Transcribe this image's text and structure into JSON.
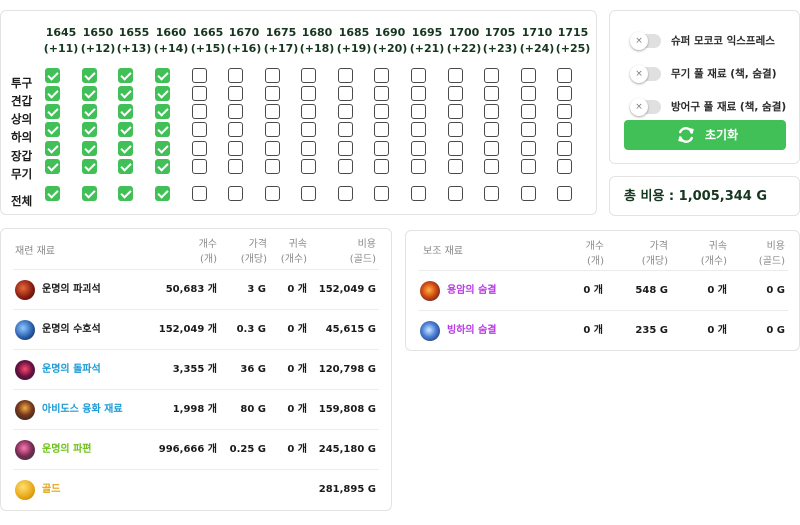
{
  "levels": [
    {
      "level": "1645",
      "bonus": "(+11)"
    },
    {
      "level": "1650",
      "bonus": "(+12)"
    },
    {
      "level": "1655",
      "bonus": "(+13)"
    },
    {
      "level": "1660",
      "bonus": "(+14)"
    },
    {
      "level": "1665",
      "bonus": "(+15)"
    },
    {
      "level": "1670",
      "bonus": "(+16)"
    },
    {
      "level": "1675",
      "bonus": "(+17)"
    },
    {
      "level": "1680",
      "bonus": "(+18)"
    },
    {
      "level": "1685",
      "bonus": "(+19)"
    },
    {
      "level": "1690",
      "bonus": "(+20)"
    },
    {
      "level": "1695",
      "bonus": "(+21)"
    },
    {
      "level": "1700",
      "bonus": "(+22)"
    },
    {
      "level": "1705",
      "bonus": "(+23)"
    },
    {
      "level": "1710",
      "bonus": "(+24)"
    },
    {
      "level": "1715",
      "bonus": "(+25)"
    }
  ],
  "rows": [
    {
      "label": "투구",
      "checked": [
        true,
        true,
        true,
        true,
        false,
        false,
        false,
        false,
        false,
        false,
        false,
        false,
        false,
        false,
        false
      ]
    },
    {
      "label": "견갑",
      "checked": [
        true,
        true,
        true,
        true,
        false,
        false,
        false,
        false,
        false,
        false,
        false,
        false,
        false,
        false,
        false
      ]
    },
    {
      "label": "상의",
      "checked": [
        true,
        true,
        true,
        true,
        false,
        false,
        false,
        false,
        false,
        false,
        false,
        false,
        false,
        false,
        false
      ]
    },
    {
      "label": "하의",
      "checked": [
        true,
        true,
        true,
        true,
        false,
        false,
        false,
        false,
        false,
        false,
        false,
        false,
        false,
        false,
        false
      ]
    },
    {
      "label": "장갑",
      "checked": [
        true,
        true,
        true,
        true,
        false,
        false,
        false,
        false,
        false,
        false,
        false,
        false,
        false,
        false,
        false
      ]
    },
    {
      "label": "무기",
      "checked": [
        true,
        true,
        true,
        true,
        false,
        false,
        false,
        false,
        false,
        false,
        false,
        false,
        false,
        false,
        false
      ]
    },
    {
      "label": "전체",
      "checked": [
        true,
        true,
        true,
        true,
        false,
        false,
        false,
        false,
        false,
        false,
        false,
        false,
        false,
        false,
        false
      ]
    }
  ],
  "options": [
    {
      "label": "슈퍼 모코코 익스프레스",
      "enabled": false
    },
    {
      "label": "무기 풀 재료 (책, 숨결)",
      "enabled": false
    },
    {
      "label": "방어구 풀 재료 (책, 숨결)",
      "enabled": false
    }
  ],
  "toggle_knob_symbol": "×",
  "reset_label": "초기화",
  "total_label": "총 비용 : 1,005,344 G",
  "colors": {
    "accent_green": "#40c057",
    "blue_label": "#1c9bd6",
    "green_label": "#6ec21a",
    "orange_label": "#e0a418",
    "purple_label": "#b83ae6"
  },
  "main_table": {
    "headers": {
      "name": "재련 재료",
      "count": [
        "개수",
        "(개)"
      ],
      "price": [
        "가격",
        "(개당)"
      ],
      "bound": [
        "귀속",
        "(개수)"
      ],
      "cost": [
        "비용",
        "(골드)"
      ]
    },
    "rows": [
      {
        "name": "운명의 파괴석",
        "color": "#1a1a1a",
        "icon": "destruction-stone-icon",
        "count": "50,683 개",
        "price": "3 G",
        "bound": "0 개",
        "cost": "152,049 G"
      },
      {
        "name": "운명의 수호석",
        "color": "#1a1a1a",
        "icon": "guardian-stone-icon",
        "count": "152,049 개",
        "price": "0.3 G",
        "bound": "0 개",
        "cost": "45,615 G"
      },
      {
        "name": "운명의 돌파석",
        "color": "#1c9bd6",
        "icon": "leapstone-icon",
        "count": "3,355 개",
        "price": "36 G",
        "bound": "0 개",
        "cost": "120,798 G"
      },
      {
        "name": "아비도스 융화 재료",
        "color": "#1c9bd6",
        "icon": "fusion-material-icon",
        "count": "1,998 개",
        "price": "80 G",
        "bound": "0 개",
        "cost": "159,808 G"
      },
      {
        "name": "운명의 파편",
        "color": "#6ec21a",
        "icon": "shard-icon",
        "count": "996,666 개",
        "price": "0.25 G",
        "bound": "0 개",
        "cost": "245,180 G"
      },
      {
        "name": "골드",
        "color": "#e0a418",
        "icon": "gold-coin-icon",
        "count": "",
        "price": "",
        "bound": "",
        "cost": "281,895 G"
      }
    ]
  },
  "sub_table": {
    "headers": {
      "name": "보조 재료",
      "count": [
        "개수",
        "(개)"
      ],
      "price": [
        "가격",
        "(개당)"
      ],
      "bound": [
        "귀속",
        "(개수)"
      ],
      "cost": [
        "비용",
        "(골드)"
      ]
    },
    "rows": [
      {
        "name": "용암의 숨결",
        "color": "#b83ae6",
        "icon": "lava-breath-icon",
        "count": "0 개",
        "price": "548 G",
        "bound": "0 개",
        "cost": "0 G"
      },
      {
        "name": "빙하의 숨결",
        "color": "#b83ae6",
        "icon": "glacier-breath-icon",
        "count": "0 개",
        "price": "235 G",
        "bound": "0 개",
        "cost": "0 G"
      }
    ]
  }
}
